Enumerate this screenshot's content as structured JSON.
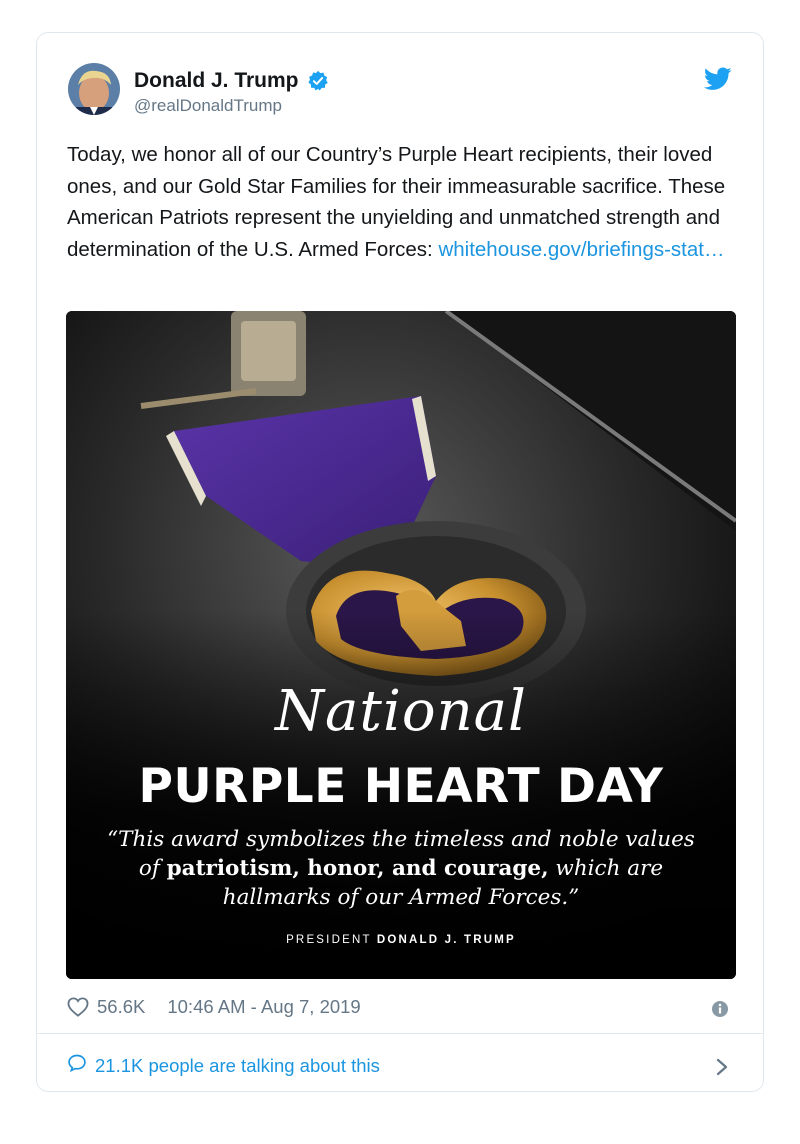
{
  "tweet": {
    "author_name": "Donald J. Trump",
    "author_handle": "@realDonaldTrump",
    "text": "Today, we honor all of our Country’s Purple Heart recipients, their loved ones, and our Gold Star Families for their immeasurable sacrifice. These American Patriots represent the unyielding and unmatched strength and determination of the U.S. Armed Forces: ",
    "link_text": "whitehouse.gov/briefings-stat…",
    "likes": "56.6K",
    "timestamp": "10:46 AM - Aug 7, 2019",
    "talking": "21.1K people are talking about this"
  },
  "media": {
    "script_title": "National",
    "title": "PURPLE HEART DAY",
    "quote_part1": "“This award symbolizes the timeless and noble values of ",
    "quote_bold": "patriotism, honor, and courage,",
    "quote_part2": " which are hallmarks of our Armed Forces.”",
    "attribution_prefix": "PRESIDENT ",
    "attribution_name": "DONALD J. TRUMP"
  },
  "icons": {
    "verified": "verified-badge-icon",
    "twitter": "twitter-bird-icon",
    "like": "heart-icon",
    "info": "info-icon",
    "comment": "comment-bubble-icon",
    "chevron": "chevron-right-icon"
  },
  "colors": {
    "link": "#1b95e0",
    "text": "#14171a",
    "muted": "#657786",
    "ribbon": "#4a2a8a",
    "gold": "#c8902f"
  }
}
